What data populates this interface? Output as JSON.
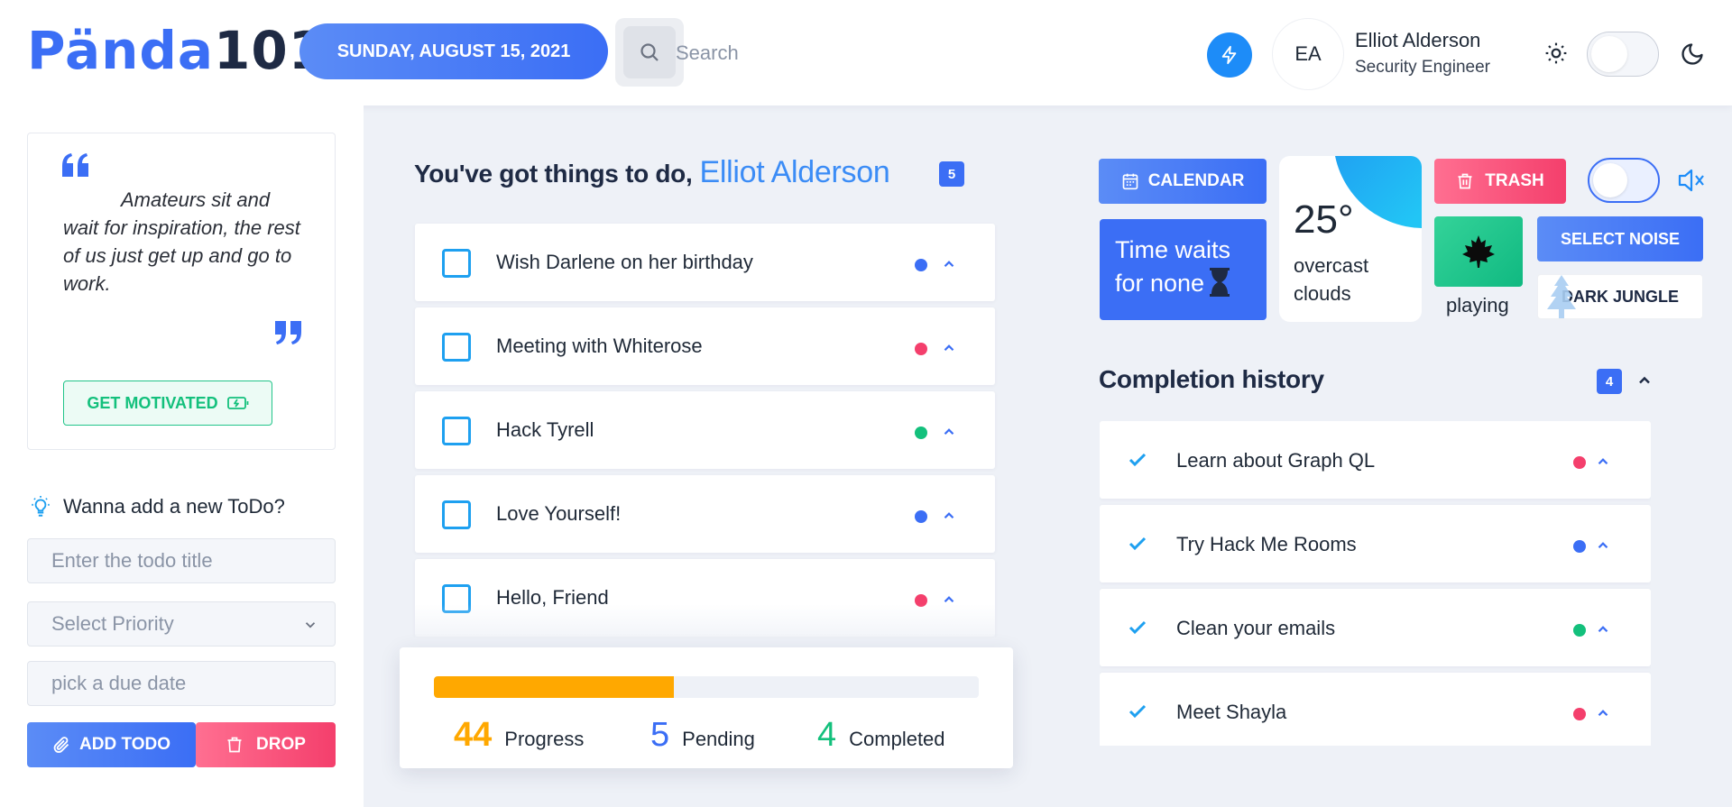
{
  "header": {
    "logo_part1": "Pända",
    "logo_part2": "101",
    "date": "SUNDAY, AUGUST 15, 2021",
    "search_placeholder": "Search",
    "avatar_initials": "EA",
    "user_name": "Elliot Alderson",
    "user_role": "Security Engineer"
  },
  "sidebar": {
    "quote": "Amateurs sit and wait for inspiration, the rest of us just get up and go to work.",
    "motivate_label": "GET MOTIVATED",
    "new_todo_heading": "Wanna add a new ToDo?",
    "title_placeholder": "Enter the todo title",
    "priority_placeholder": "Select Priority",
    "due_placeholder": "pick a due date",
    "add_label": "ADD TODO",
    "drop_label": "DROP"
  },
  "todos": {
    "greeting": "You've got things to do,",
    "name": "Elliot Alderson",
    "count": "5",
    "items": [
      {
        "text": "Wish Darlene on her birthday",
        "color": "#3b6ef5"
      },
      {
        "text": "Meeting with Whiterose",
        "color": "#f43f6c"
      },
      {
        "text": "Hack Tyrell",
        "color": "#13c07c"
      },
      {
        "text": "Love Yourself!",
        "color": "#3b6ef5"
      },
      {
        "text": "Hello, Friend",
        "color": "#f43f6c"
      }
    ]
  },
  "progress": {
    "percent": 44,
    "progress_value": "44",
    "progress_label": "Progress",
    "pending_value": "5",
    "pending_label": "Pending",
    "completed_value": "4",
    "completed_label": "Completed"
  },
  "right": {
    "calendar_label": "CALENDAR",
    "time_text_line1": "Time waits",
    "time_text_line2": "for none",
    "temperature": "25°",
    "weather_desc": "overcast clouds",
    "trash_label": "TRASH",
    "playing_label": "playing",
    "select_noise_label": "SELECT NOISE",
    "noise_name": "DARK JUNGLE"
  },
  "history": {
    "title": "Completion history",
    "count": "4",
    "items": [
      {
        "text": "Learn about Graph QL",
        "color": "#f43f6c"
      },
      {
        "text": "Try Hack Me Rooms",
        "color": "#3b6ef5"
      },
      {
        "text": "Clean your emails",
        "color": "#13c07c"
      },
      {
        "text": "Meet Shayla",
        "color": "#f43f6c"
      }
    ]
  },
  "colors": {
    "accent": "#3b6ef5",
    "danger": "#f43f6c",
    "success": "#13c07c",
    "warning": "#ffa800"
  },
  "icons": [
    "search-icon",
    "bolt-icon",
    "sun-icon",
    "moon-icon",
    "quote-open-icon",
    "quote-close-icon",
    "battery-icon",
    "lightbulb-icon",
    "chevron-down-icon",
    "paperclip-icon",
    "trash-icon",
    "calendar-icon",
    "hourglass-icon",
    "mute-icon",
    "maple-leaf-icon",
    "tree-icon",
    "chevron-up-icon",
    "check-icon"
  ]
}
